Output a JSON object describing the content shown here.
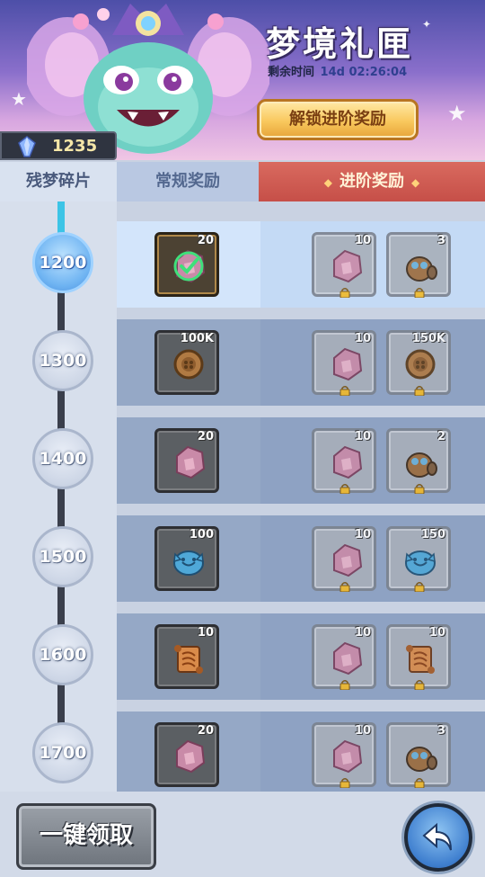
{
  "header": {
    "title": "梦境礼匣",
    "timer_label": "剩余时间",
    "timer_value": "14d 02:26:04",
    "unlock_button": "解锁进阶奖励"
  },
  "currency": {
    "amount": "1235",
    "icon": "crystal-icon"
  },
  "tabs": {
    "fragments": "残梦碎片",
    "normal": "常规奖励",
    "advanced": "进阶奖励"
  },
  "tiers": [
    {
      "level": "1200",
      "normal": {
        "qty": "20",
        "icon": "crystal-shard-icon",
        "claimed": true
      },
      "adv": [
        {
          "qty": "10",
          "icon": "crystal-shard-icon"
        },
        {
          "qty": "3",
          "icon": "golem-icon"
        }
      ]
    },
    {
      "level": "1300",
      "normal": {
        "qty": "100K",
        "icon": "coin-icon",
        "claimed": false
      },
      "adv": [
        {
          "qty": "10",
          "icon": "crystal-shard-icon"
        },
        {
          "qty": "150K",
          "icon": "coin-icon"
        }
      ]
    },
    {
      "level": "1400",
      "normal": {
        "qty": "20",
        "icon": "crystal-shard-icon",
        "claimed": false
      },
      "adv": [
        {
          "qty": "10",
          "icon": "crystal-shard-icon"
        },
        {
          "qty": "2",
          "icon": "golem-icon"
        }
      ]
    },
    {
      "level": "1500",
      "normal": {
        "qty": "100",
        "icon": "blue-slime-icon",
        "claimed": false
      },
      "adv": [
        {
          "qty": "10",
          "icon": "crystal-shard-icon"
        },
        {
          "qty": "150",
          "icon": "blue-slime-icon"
        }
      ]
    },
    {
      "level": "1600",
      "normal": {
        "qty": "10",
        "icon": "scroll-icon",
        "claimed": false
      },
      "adv": [
        {
          "qty": "10",
          "icon": "crystal-shard-icon"
        },
        {
          "qty": "10",
          "icon": "scroll-icon"
        }
      ]
    },
    {
      "level": "1700",
      "normal": {
        "qty": "20",
        "icon": "crystal-shard-icon",
        "claimed": false
      },
      "adv": [
        {
          "qty": "10",
          "icon": "crystal-shard-icon"
        },
        {
          "qty": "3",
          "icon": "golem-icon"
        }
      ]
    }
  ],
  "progress": {
    "active_tier": "1200"
  },
  "buttons": {
    "claim_all": "一键领取",
    "back_icon": "back-arrow-icon"
  },
  "colors": {
    "accent_red": "#c64f48",
    "active_blue": "#6fb4f2",
    "gold": "#f9c85d"
  }
}
